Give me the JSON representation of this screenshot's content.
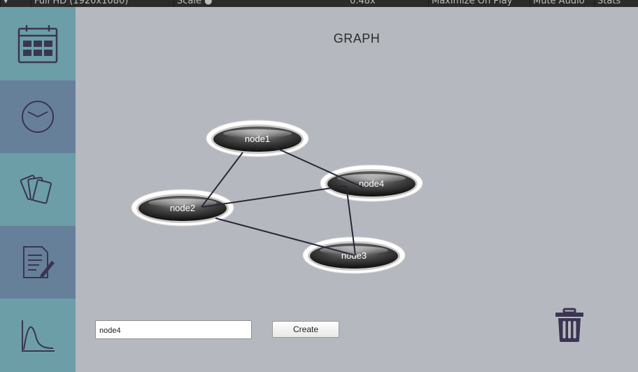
{
  "toolbar": {
    "resolution": "Full HD (1920x1080)",
    "scale_label": "Scale",
    "scale_value": "0.48x",
    "maximize": "Maximize On Play",
    "mute": "Mute Audio",
    "stats": "Stats"
  },
  "sidebar": {
    "items": [
      {
        "icon": "calendar-icon",
        "color": "#6b9ea6"
      },
      {
        "icon": "clock-icon",
        "color": "#67809a"
      },
      {
        "icon": "cards-icon",
        "color": "#6b9ea6"
      },
      {
        "icon": "notes-icon",
        "color": "#67809a"
      },
      {
        "icon": "chart-icon",
        "color": "#6b9ea6"
      }
    ],
    "icon_color": "#3b3552"
  },
  "page": {
    "title": "GRAPH"
  },
  "graph": {
    "nodes": [
      {
        "id": "node1",
        "label": "node1"
      },
      {
        "id": "node2",
        "label": "node2"
      },
      {
        "id": "node3",
        "label": "node3"
      },
      {
        "id": "node4",
        "label": "node4"
      }
    ],
    "edges": [
      [
        "node1",
        "node2"
      ],
      [
        "node1",
        "node4"
      ],
      [
        "node2",
        "node4"
      ],
      [
        "node2",
        "node3"
      ],
      [
        "node4",
        "node3"
      ]
    ]
  },
  "form": {
    "input_value": "node4",
    "create_label": "Create"
  },
  "colors": {
    "background": "#b6b8bf",
    "sidebar_teal": "#6b9ea6",
    "sidebar_slate": "#67809a",
    "edge": "#2a2838",
    "trash": "#3b3552"
  }
}
